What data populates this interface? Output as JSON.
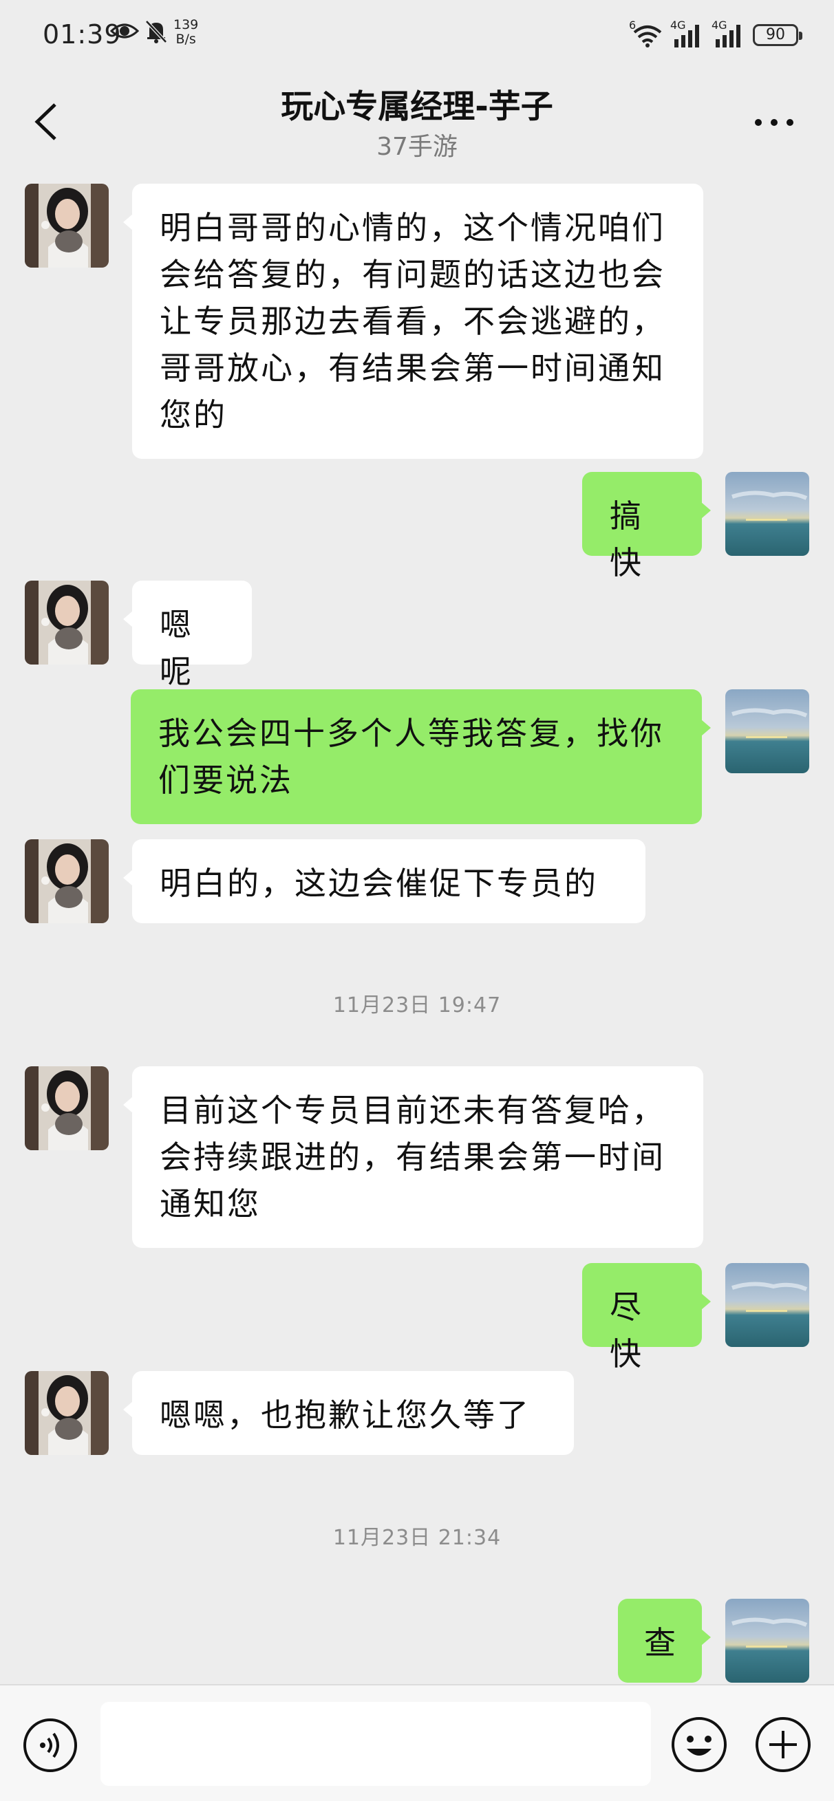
{
  "status_bar": {
    "time": "01:39",
    "net_speed_value": "139",
    "net_speed_unit": "B/s",
    "signal1_label": "4G",
    "signal2_label": "4G",
    "wifi_label": "6",
    "battery": "90"
  },
  "header": {
    "title": "玩心专属经理-芋子",
    "subtitle": "37手游"
  },
  "messages": [
    {
      "side": "in",
      "text": "明白哥哥的心情的，这个情况咱们会给答复的，有问题的话这边也会让专员那边去看看，不会逃避的，哥哥放心，有结果会第一时间通知您的"
    },
    {
      "side": "out",
      "text": "搞快"
    },
    {
      "side": "in",
      "text": "嗯呢"
    },
    {
      "side": "out",
      "text": "我公会四十多个人等我答复，找你们要说法"
    },
    {
      "side": "in",
      "text": "明白的，这边会催促下专员的"
    },
    {
      "side": "time",
      "text": "11月23日 19:47"
    },
    {
      "side": "in",
      "text": "目前这个专员目前还未有答复哈，会持续跟进的，有结果会第一时间通知您"
    },
    {
      "side": "out",
      "text": "尽快"
    },
    {
      "side": "in",
      "text": "嗯嗯，也抱歉让您久等了"
    },
    {
      "side": "time",
      "text": "11月23日 21:34"
    },
    {
      "side": "out",
      "text": "查"
    }
  ],
  "input": {
    "value": "",
    "placeholder": ""
  },
  "icons": {
    "back": "chevron-left-icon",
    "more": "more-horizontal-icon",
    "voice": "voice-icon",
    "emoji": "emoji-icon",
    "plus": "plus-icon"
  },
  "colors": {
    "background": "#ededed",
    "incoming_bubble": "#ffffff",
    "outgoing_bubble": "#95ec69",
    "timestamp": "#8c8c8c"
  }
}
